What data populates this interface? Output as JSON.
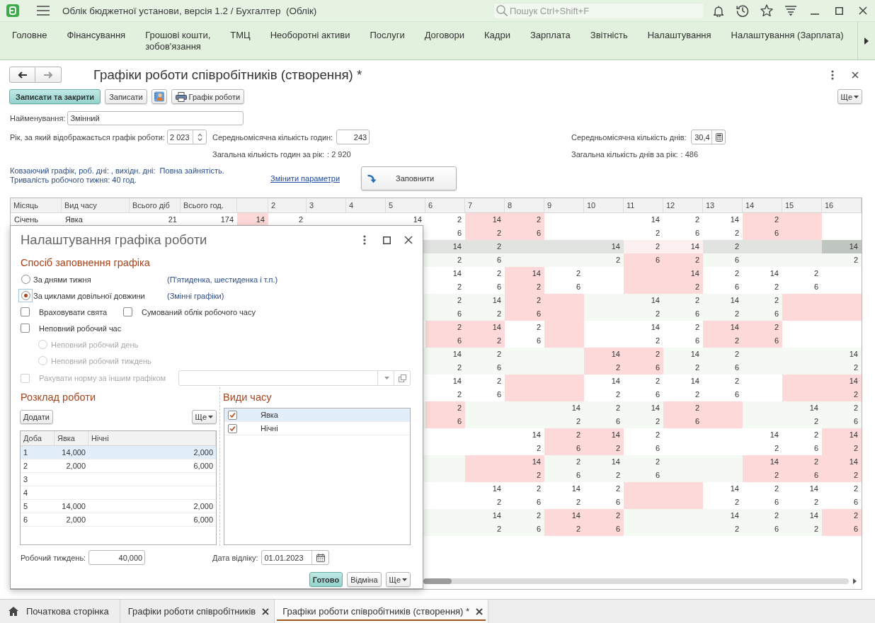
{
  "app_bar": {
    "title": "Облік бюджетної установи, версія 1.2 / Бухгалтер  (Облік)",
    "search": {
      "placeholder": "Пошук Ctrl+Shift+F"
    }
  },
  "sections": [
    "Головне",
    "Фінансування",
    "Грошові кошти,\nзобов'язання",
    "ТМЦ",
    "Необоротні активи",
    "Послуги",
    "Договори",
    "Кадри",
    "Зарплата",
    "Звітність",
    "Налаштування",
    "Налаштування (Зарплата)"
  ],
  "form": {
    "nav": {
      "back_disabled": false,
      "forward_disabled": true
    },
    "title": "Графіки роботи співробітників (створення) *",
    "buttons": {
      "save_and_close": "Записати та закрити",
      "save": "Записати",
      "print_schedule": "Графік роботи",
      "more": "Ще"
    },
    "name": {
      "label": "Найменування:",
      "value": "Змінний"
    },
    "year": {
      "label": "Рік, за який відображається графік роботи:",
      "value": "2 023"
    },
    "avg_monthly_hours": {
      "label": "Середньомісячна кількість годин:",
      "value": "243"
    },
    "avg_monthly_days": {
      "label": "Середньомісячна кількість днів:",
      "value": "30,4"
    },
    "total_hours": {
      "label": "Загальна кількість годин за рік:",
      "value": ": 2 920"
    },
    "total_days": {
      "label": "Загальна кількість днів за рік:",
      "value": ": 486"
    },
    "summary": [
      "Ковзаючий графік, роб. дні: , вихідн. дні:  Повна зайнятість.",
      "Тривалість робочого тижня: 40 год."
    ],
    "change_link": "Змінити параметри",
    "fill_button": "Заповнити"
  },
  "grid": {
    "columns": [
      "Місяць",
      "Вид часу",
      "Всього діб",
      "Всього год."
    ],
    "day_columns": [
      "2",
      "3",
      "4",
      "5",
      "6",
      "7",
      "8",
      "9",
      "10",
      "11",
      "12",
      "13",
      "14",
      "15",
      "16"
    ],
    "months": [
      {
        "name": "Січень",
        "lines": [
          {
            "time_type": "Явка",
            "total_days": "21",
            "total_hours": "174",
            "selected": false,
            "cells": [
              {
                "value": "14",
                "day_off": true
              },
              {
                "value": "2",
                "day_off": false
              },
              {
                "day_off": false
              },
              {
                "day_off": false
              },
              {
                "value": "14",
                "day_off": false
              },
              {
                "value": "2",
                "day_off": false
              },
              {
                "value": "14",
                "day_off": true
              },
              {
                "value": "2",
                "day_off": true
              },
              {
                "day_off": false
              },
              {
                "day_off": false
              },
              {
                "value": "14",
                "day_off": false
              },
              {
                "value": "2",
                "day_off": false
              },
              {
                "value": "14",
                "day_off": false
              },
              {
                "value": "2",
                "day_off": true
              },
              {
                "day_off": true
              },
              {
                "day_off": false
              }
            ]
          },
          {
            "selected": false,
            "cells": [
              {
                "value": "6",
                "day_off": false
              },
              {
                "value": "2",
                "day_off": true
              },
              {
                "value": "6",
                "day_off": true
              },
              {
                "day_off": false
              },
              {
                "day_off": false
              },
              {
                "value": "2",
                "day_off": false
              },
              {
                "value": "6",
                "day_off": false
              },
              {
                "value": "2",
                "day_off": false
              },
              {
                "value": "6",
                "day_off": true
              },
              {
                "day_off": true
              },
              {
                "day_off": false
              }
            ]
          }
        ]
      },
      {
        "lines": [
          {
            "selected": true,
            "cells": [
              {
                "value": "14",
                "day_off": false
              },
              {
                "value": "2",
                "day_off": false
              },
              {
                "day_off": false
              },
              {
                "day_off": false
              },
              {
                "value": "14",
                "day_off": false
              },
              {
                "value": "2",
                "day_off": true
              },
              {
                "value": "14",
                "day_off": true
              },
              {
                "value": "2",
                "day_off": false
              },
              {
                "day_off": false
              },
              {
                "day_off": false
              },
              {
                "value": "14",
                "day_off": false,
                "current": true
              }
            ]
          },
          {
            "selected": false,
            "cells": [
              {
                "value": "2",
                "day_off": false
              },
              {
                "value": "6",
                "day_off": false
              },
              {
                "day_off": false
              },
              {
                "day_off": false
              },
              {
                "value": "2",
                "day_off": false
              },
              {
                "value": "6",
                "day_off": true
              },
              {
                "value": "2",
                "day_off": true
              },
              {
                "value": "6",
                "day_off": false
              },
              {
                "day_off": false
              },
              {
                "day_off": false
              },
              {
                "value": "2",
                "day_off": false
              }
            ]
          }
        ]
      },
      {
        "lines": [
          {
            "selected": false,
            "cells": [
              {
                "value": "14",
                "day_off": false
              },
              {
                "value": "2",
                "day_off": false
              },
              {
                "value": "14",
                "day_off": true
              },
              {
                "value": "2",
                "day_off": false
              },
              {
                "day_off": false
              },
              {
                "day_off": true
              },
              {
                "value": "14",
                "day_off": true
              },
              {
                "value": "2",
                "day_off": false
              },
              {
                "value": "14",
                "day_off": false
              },
              {
                "value": "2",
                "day_off": false
              },
              {
                "day_off": false
              }
            ]
          },
          {
            "selected": false,
            "cells": [
              {
                "value": "2",
                "day_off": false
              },
              {
                "value": "6",
                "day_off": false
              },
              {
                "value": "2",
                "day_off": true
              },
              {
                "value": "6",
                "day_off": false
              },
              {
                "day_off": false
              },
              {
                "day_off": true
              },
              {
                "value": "2",
                "day_off": true
              },
              {
                "value": "6",
                "day_off": false
              },
              {
                "value": "2",
                "day_off": false
              },
              {
                "value": "6",
                "day_off": false
              },
              {
                "day_off": false
              }
            ]
          }
        ]
      },
      {
        "lines": [
          {
            "selected": false,
            "cells": [
              {
                "value": "2",
                "day_off": false
              },
              {
                "value": "14",
                "day_off": false
              },
              {
                "value": "2",
                "day_off": true
              },
              {
                "day_off": true
              },
              {
                "day_off": false
              },
              {
                "value": "14",
                "day_off": false
              },
              {
                "value": "2",
                "day_off": false
              },
              {
                "value": "14",
                "day_off": false
              },
              {
                "value": "2",
                "day_off": false
              },
              {
                "day_off": true
              },
              {
                "day_off": true
              }
            ]
          },
          {
            "selected": false,
            "cells": [
              {
                "value": "6",
                "day_off": false
              },
              {
                "value": "2",
                "day_off": false
              },
              {
                "value": "6",
                "day_off": true
              },
              {
                "day_off": true
              },
              {
                "day_off": false
              },
              {
                "value": "2",
                "day_off": false
              },
              {
                "value": "6",
                "day_off": false
              },
              {
                "value": "2",
                "day_off": false
              },
              {
                "value": "6",
                "day_off": false
              },
              {
                "day_off": true
              },
              {
                "day_off": true
              }
            ]
          }
        ]
      },
      {
        "lines": [
          {
            "selected": false,
            "cells": [
              {
                "value": "2",
                "day_off": true
              },
              {
                "value": "14",
                "day_off": true
              },
              {
                "value": "2",
                "day_off": false
              },
              {
                "day_off": true
              },
              {
                "day_off": false
              },
              {
                "value": "14",
                "day_off": false
              },
              {
                "value": "2",
                "day_off": false
              },
              {
                "value": "14",
                "day_off": true
              },
              {
                "value": "2",
                "day_off": true
              },
              {
                "day_off": false
              },
              {
                "day_off": false
              }
            ]
          },
          {
            "selected": false,
            "cells": [
              {
                "value": "6",
                "day_off": true
              },
              {
                "value": "2",
                "day_off": true
              },
              {
                "value": "6",
                "day_off": false
              },
              {
                "day_off": true
              },
              {
                "day_off": false
              },
              {
                "value": "2",
                "day_off": false
              },
              {
                "value": "6",
                "day_off": false
              },
              {
                "value": "2",
                "day_off": true
              },
              {
                "value": "6",
                "day_off": true
              },
              {
                "day_off": false
              },
              {
                "day_off": false
              }
            ]
          }
        ]
      },
      {
        "lines": [
          {
            "selected": false,
            "cells": [
              {
                "value": "14",
                "day_off": false
              },
              {
                "value": "2",
                "day_off": false
              },
              {
                "day_off": false
              },
              {
                "day_off": false
              },
              {
                "value": "14",
                "day_off": true
              },
              {
                "value": "2",
                "day_off": true
              },
              {
                "value": "14",
                "day_off": false
              },
              {
                "value": "2",
                "day_off": false
              },
              {
                "day_off": false
              },
              {
                "day_off": false
              },
              {
                "value": "14",
                "day_off": false
              }
            ]
          },
          {
            "selected": false,
            "cells": [
              {
                "value": "2",
                "day_off": false
              },
              {
                "value": "6",
                "day_off": false
              },
              {
                "day_off": false
              },
              {
                "day_off": false
              },
              {
                "value": "2",
                "day_off": true
              },
              {
                "value": "6",
                "day_off": true
              },
              {
                "value": "2",
                "day_off": false
              },
              {
                "value": "6",
                "day_off": false
              },
              {
                "day_off": false
              },
              {
                "day_off": false
              },
              {
                "value": "2",
                "day_off": false
              }
            ]
          }
        ]
      },
      {
        "lines": [
          {
            "selected": false,
            "cells": [
              {
                "value": "14",
                "day_off": false
              },
              {
                "value": "2",
                "day_off": false
              },
              {
                "day_off": true
              },
              {
                "day_off": true
              },
              {
                "value": "14",
                "day_off": false
              },
              {
                "value": "2",
                "day_off": false
              },
              {
                "value": "14",
                "day_off": false
              },
              {
                "value": "2",
                "day_off": false
              },
              {
                "day_off": false
              },
              {
                "day_off": true
              },
              {
                "value": "14",
                "day_off": true
              }
            ]
          },
          {
            "selected": false,
            "cells": [
              {
                "value": "2",
                "day_off": false
              },
              {
                "value": "6",
                "day_off": false
              },
              {
                "day_off": true
              },
              {
                "day_off": true
              },
              {
                "value": "2",
                "day_off": false
              },
              {
                "value": "6",
                "day_off": false
              },
              {
                "value": "2",
                "day_off": false
              },
              {
                "value": "6",
                "day_off": false
              },
              {
                "day_off": false
              },
              {
                "day_off": true
              },
              {
                "value": "2",
                "day_off": true
              }
            ]
          }
        ]
      },
      {
        "lines": [
          {
            "selected": false,
            "cells": [
              {
                "value": "2",
                "day_off": true
              },
              {
                "day_off": false
              },
              {
                "day_off": false
              },
              {
                "value": "14",
                "day_off": false
              },
              {
                "value": "2",
                "day_off": false
              },
              {
                "value": "14",
                "day_off": false
              },
              {
                "value": "2",
                "day_off": true
              },
              {
                "day_off": true
              },
              {
                "day_off": false
              },
              {
                "value": "14",
                "day_off": false
              },
              {
                "value": "2",
                "day_off": false
              }
            ]
          },
          {
            "selected": false,
            "cells": [
              {
                "value": "6",
                "day_off": true
              },
              {
                "day_off": false
              },
              {
                "day_off": false
              },
              {
                "value": "2",
                "day_off": false
              },
              {
                "value": "6",
                "day_off": false
              },
              {
                "value": "2",
                "day_off": false
              },
              {
                "value": "6",
                "day_off": true
              },
              {
                "day_off": true
              },
              {
                "day_off": false
              },
              {
                "value": "2",
                "day_off": false
              },
              {
                "value": "6",
                "day_off": false
              }
            ]
          }
        ]
      },
      {
        "lines": [
          {
            "selected": false,
            "cells": [
              {
                "day_off": false
              },
              {
                "day_off": false
              },
              {
                "value": "14",
                "day_off": false
              },
              {
                "value": "2",
                "day_off": true
              },
              {
                "value": "14",
                "day_off": true
              },
              {
                "value": "2",
                "day_off": false
              },
              {
                "day_off": false
              },
              {
                "day_off": false
              },
              {
                "value": "14",
                "day_off": false
              },
              {
                "value": "2",
                "day_off": false
              },
              {
                "value": "14",
                "day_off": true
              }
            ]
          },
          {
            "selected": false,
            "cells": [
              {
                "day_off": false
              },
              {
                "day_off": false
              },
              {
                "value": "2",
                "day_off": false
              },
              {
                "value": "6",
                "day_off": true
              },
              {
                "value": "2",
                "day_off": true
              },
              {
                "value": "6",
                "day_off": false
              },
              {
                "day_off": false
              },
              {
                "day_off": false
              },
              {
                "value": "2",
                "day_off": false
              },
              {
                "value": "6",
                "day_off": false
              },
              {
                "value": "2",
                "day_off": true
              }
            ]
          }
        ]
      },
      {
        "lines": [
          {
            "selected": false,
            "cells": [
              {
                "day_off": false
              },
              {
                "day_off": true
              },
              {
                "value": "14",
                "day_off": true
              },
              {
                "value": "2",
                "day_off": false
              },
              {
                "value": "14",
                "day_off": false
              },
              {
                "value": "2",
                "day_off": false
              },
              {
                "day_off": false
              },
              {
                "day_off": false
              },
              {
                "value": "14",
                "day_off": true
              },
              {
                "value": "2",
                "day_off": true
              },
              {
                "value": "14",
                "day_off": true
              }
            ]
          },
          {
            "selected": false,
            "cells": [
              {
                "day_off": false
              },
              {
                "day_off": true
              },
              {
                "value": "2",
                "day_off": true
              },
              {
                "value": "6",
                "day_off": false
              },
              {
                "value": "2",
                "day_off": false
              },
              {
                "value": "6",
                "day_off": false
              },
              {
                "day_off": false
              },
              {
                "day_off": false
              },
              {
                "value": "2",
                "day_off": true
              },
              {
                "value": "6",
                "day_off": true
              },
              {
                "value": "2",
                "day_off": true
              }
            ]
          }
        ]
      },
      {
        "lines": [
          {
            "selected": false,
            "cells": [
              {
                "day_off": false
              },
              {
                "value": "14",
                "day_off": false
              },
              {
                "value": "2",
                "day_off": false
              },
              {
                "value": "14",
                "day_off": false
              },
              {
                "value": "2",
                "day_off": false
              },
              {
                "day_off": true
              },
              {
                "day_off": true
              },
              {
                "value": "14",
                "day_off": false
              },
              {
                "value": "2",
                "day_off": false
              },
              {
                "value": "14",
                "day_off": false
              },
              {
                "value": "2",
                "day_off": false
              }
            ]
          },
          {
            "selected": false,
            "cells": [
              {
                "day_off": false
              },
              {
                "value": "2",
                "day_off": false
              },
              {
                "value": "6",
                "day_off": false
              },
              {
                "value": "2",
                "day_off": false
              },
              {
                "value": "6",
                "day_off": false
              },
              {
                "day_off": true
              },
              {
                "day_off": true
              },
              {
                "value": "2",
                "day_off": false
              },
              {
                "value": "6",
                "day_off": false
              },
              {
                "value": "2",
                "day_off": false
              },
              {
                "value": "6",
                "day_off": false
              }
            ]
          }
        ]
      },
      {
        "lines": [
          {
            "selected": false,
            "cells": [
              {
                "day_off": false
              },
              {
                "value": "14",
                "day_off": false
              },
              {
                "value": "2",
                "day_off": false
              },
              {
                "value": "14",
                "day_off": true
              },
              {
                "value": "2",
                "day_off": true
              },
              {
                "day_off": false
              },
              {
                "day_off": false
              },
              {
                "value": "14",
                "day_off": false
              },
              {
                "value": "2",
                "day_off": false
              },
              {
                "value": "14",
                "day_off": false
              },
              {
                "value": "2",
                "day_off": true
              }
            ]
          },
          {
            "selected": false,
            "cells": [
              {
                "day_off": false
              },
              {
                "value": "2",
                "day_off": false
              },
              {
                "value": "6",
                "day_off": false
              },
              {
                "value": "2",
                "day_off": true
              },
              {
                "value": "6",
                "day_off": true
              },
              {
                "day_off": false
              },
              {
                "day_off": false
              },
              {
                "value": "2",
                "day_off": false
              },
              {
                "value": "6",
                "day_off": false
              },
              {
                "value": "2",
                "day_off": false
              },
              {
                "value": "6",
                "day_off": true
              }
            ]
          }
        ]
      }
    ]
  },
  "dialog": {
    "title": "Налаштування графіка роботи",
    "fill_method": {
      "heading": "Спосіб заповнення графіка",
      "options": [
        {
          "label": "За днями тижня",
          "hint": "(П'ятиденка, шестиденка і т.п.)",
          "selected": false,
          "focused": false
        },
        {
          "label": "За циклами довільної довжини",
          "hint": "(Змінні графіки)",
          "selected": true,
          "focused": true
        }
      ]
    },
    "consider_holidays": {
      "label": "Враховувати свята",
      "checked": false
    },
    "summed_accounting": {
      "label": "Сумований облік робочого часу",
      "checked": false
    },
    "part_time": {
      "label": "Неповний робочий час",
      "checked": false,
      "modes": [
        {
          "label": "Неповний робочий день",
          "selected": false,
          "disabled": true
        },
        {
          "label": "Неповний робочий тиждень",
          "selected": false,
          "disabled": true
        }
      ]
    },
    "norm_by_other_schedule": {
      "label": "Рахувати норму за іншим графіком",
      "checked": false,
      "disabled": true
    },
    "schedule": {
      "heading": "Розклад роботи",
      "add_button": "Додати",
      "more_button": "Ще",
      "columns": [
        "Доба",
        "Явка",
        "Нічні"
      ],
      "rows": [
        {
          "cells": [
            "1",
            "14,000",
            "2,000"
          ],
          "selected": true
        },
        {
          "cells": [
            "2",
            "2,000",
            "6,000"
          ],
          "selected": false
        },
        {
          "cells": [
            "3"
          ],
          "selected": false
        },
        {
          "cells": [
            "4"
          ],
          "selected": false
        },
        {
          "cells": [
            "5",
            "14,000",
            "2,000"
          ],
          "selected": false
        },
        {
          "cells": [
            "6",
            "2,000",
            "6,000"
          ],
          "selected": false
        }
      ]
    },
    "time_types": {
      "heading": "Види часу",
      "items": [
        {
          "label": "Явка",
          "checked": true,
          "selected": true
        },
        {
          "label": "Нічні",
          "checked": true,
          "selected": false
        }
      ]
    },
    "work_week": {
      "label": "Робочий тиждень:",
      "value": "40,000"
    },
    "start_date": {
      "label": "Дата відліку:",
      "value": "01.01.2023"
    },
    "buttons": {
      "done": "Готово",
      "cancel": "Відміна",
      "more": "Ще"
    }
  },
  "tabs": [
    {
      "label": "Початкова сторінка",
      "kind": "home",
      "selected": false
    },
    {
      "label": "Графіки роботи співробітників",
      "kind": "document",
      "selected": false
    },
    {
      "label": "Графіки роботи співробітників (створення) *",
      "kind": "document",
      "selected": true
    }
  ]
}
